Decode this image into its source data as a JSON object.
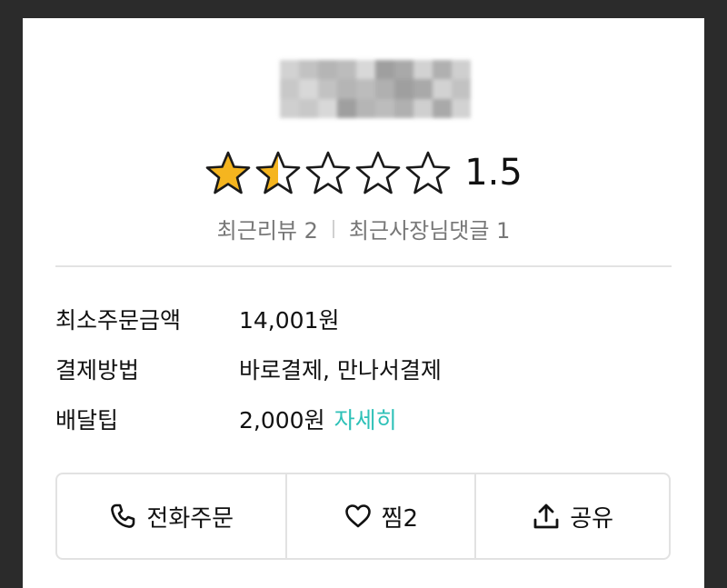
{
  "store": {
    "rating": "1.5",
    "rating_value": 1.5,
    "rating_max": 5
  },
  "reviews": {
    "recent_reviews": "최근리뷰 2",
    "recent_owner_replies": "최근사장님댓글 1"
  },
  "info": {
    "min_order_label": "최소주문금액",
    "min_order_value": "14,001원",
    "payment_label": "결제방법",
    "payment_value": "바로결제, 만나서결제",
    "delivery_tip_label": "배달팁",
    "delivery_tip_value": "2,000원",
    "detail_link": "자세히"
  },
  "actions": {
    "call_label": "전화주문",
    "favorite_label": "찜2",
    "share_label": "공유"
  },
  "colors": {
    "accent": "#2ec1b8",
    "star_fill": "#f5b51f",
    "background": "#ffffff"
  },
  "icons": {
    "call": "phone-icon",
    "favorite": "heart-icon",
    "share": "share-icon",
    "star": "star-icon"
  }
}
